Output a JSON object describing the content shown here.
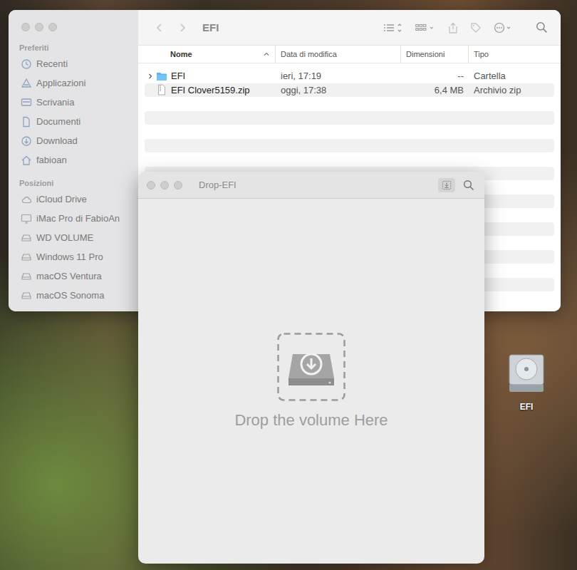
{
  "finder": {
    "title": "EFI",
    "sidebar": {
      "sections": [
        {
          "heading": "Preferiti",
          "items": [
            {
              "label": "Recenti",
              "kind": "recent"
            },
            {
              "label": "Applicazioni",
              "kind": "apps"
            },
            {
              "label": "Scrivania",
              "kind": "desktop"
            },
            {
              "label": "Documenti",
              "kind": "document"
            },
            {
              "label": "Download",
              "kind": "download"
            },
            {
              "label": "fabioan",
              "kind": "home"
            }
          ]
        },
        {
          "heading": "Posizioni",
          "items": [
            {
              "label": "iCloud Drive",
              "kind": "cloud"
            },
            {
              "label": "iMac Pro di FabioAn",
              "kind": "computer"
            },
            {
              "label": "WD VOLUME",
              "kind": "disk"
            },
            {
              "label": "Windows 11 Pro",
              "kind": "disk"
            },
            {
              "label": "macOS Ventura",
              "kind": "disk"
            },
            {
              "label": "macOS Sonoma",
              "kind": "disk"
            }
          ]
        }
      ]
    },
    "columns": [
      {
        "label": "Nome",
        "sorted": true,
        "ascending": true
      },
      {
        "label": "Data di modifica",
        "sorted": false,
        "ascending": false
      },
      {
        "label": "Dimensioni",
        "sorted": false,
        "ascending": false
      },
      {
        "label": "Tipo",
        "sorted": false,
        "ascending": false
      }
    ],
    "rows": [
      {
        "name": "EFI",
        "modified": "ieri, 17:19",
        "size": "--",
        "type": "Cartella",
        "kind": "folder",
        "expanded": false
      },
      {
        "name": "EFI Clover5159.zip",
        "modified": "oggi, 17:38",
        "size": "6,4 MB",
        "type": "Archivio zip",
        "kind": "zip",
        "expanded": false
      }
    ]
  },
  "dropWindow": {
    "title": "Drop-EFI",
    "prompt": "Drop the volume Here",
    "selectButtonActive": true
  },
  "desktopIcons": [
    {
      "label": "EFI"
    }
  ]
}
